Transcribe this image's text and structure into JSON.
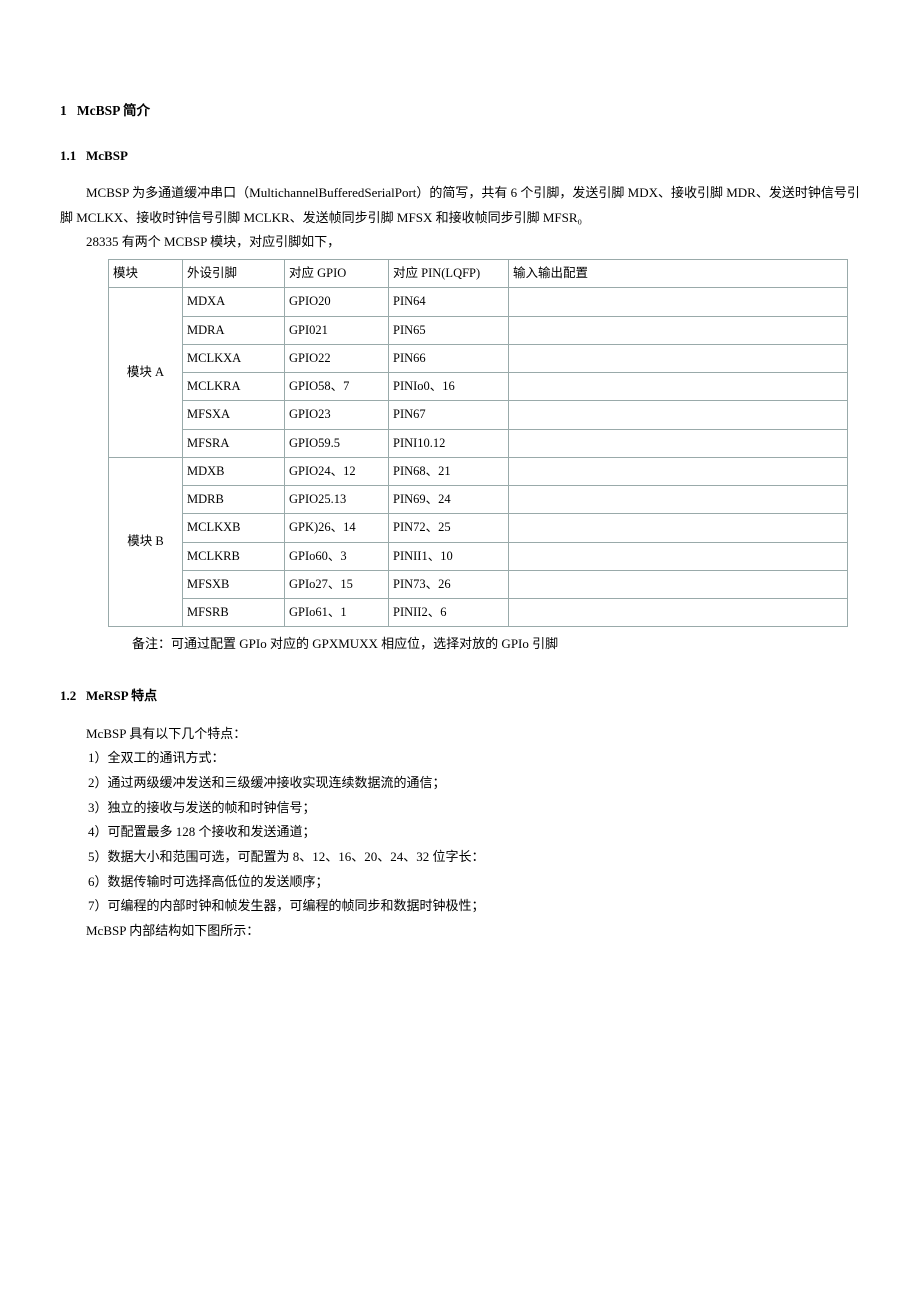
{
  "sec1": {
    "num": "1",
    "title": "McBSP 简介"
  },
  "sec11": {
    "num": "1.1",
    "title": "McBSP"
  },
  "para1": "MCBSP 为多通道缓冲串口（MultichannelBufferedSerialPort）的简写，共有 6 个引脚，发送引脚 MDX、接收引脚 MDR、发送时钟信号引脚 MCLKX、接收时钟信号引脚 MCLKR、发送帧同步引脚 MFSX 和接收帧同步引脚 MFSR₀",
  "para2": "28335 有两个 MCBSP 模块，对应引脚如下，",
  "table": {
    "headers": {
      "mod": "模块",
      "pin": "外设引脚",
      "gpio": "对应 GPIO",
      "pinlqfp": "对应 PIN(LQFP)",
      "io": "输入输出配置"
    },
    "modA": "模块 A",
    "modB": "模块 B",
    "rowsA": [
      {
        "pin": "MDXA",
        "gpio": "GPIO20",
        "pinlqfp": "PIN64",
        "io": ""
      },
      {
        "pin": "MDRA",
        "gpio": "GPI021",
        "pinlqfp": "PIN65",
        "io": ""
      },
      {
        "pin": "MCLKXA",
        "gpio": "GPIO22",
        "pinlqfp": "PIN66",
        "io": ""
      },
      {
        "pin": "MCLKRA",
        "gpio": "GPIO58、7",
        "pinlqfp": "PINIo0、16",
        "io": ""
      },
      {
        "pin": "MFSXA",
        "gpio": "GPIO23",
        "pinlqfp": "PIN67",
        "io": ""
      },
      {
        "pin": "MFSRA",
        "gpio": "GPIO59.5",
        "pinlqfp": "PINI10.12",
        "io": ""
      }
    ],
    "rowsB": [
      {
        "pin": "MDXB",
        "gpio": "GPIO24、12",
        "pinlqfp": "PIN68、21",
        "io": ""
      },
      {
        "pin": "MDRB",
        "gpio": "GPIO25.13",
        "pinlqfp": "PIN69、24",
        "io": ""
      },
      {
        "pin": "MCLKXB",
        "gpio": "GPK)26、14",
        "pinlqfp": "PIN72、25",
        "io": ""
      },
      {
        "pin": "MCLKRB",
        "gpio": "GPIo60、3",
        "pinlqfp": "PINII1、10",
        "io": ""
      },
      {
        "pin": "MFSXB",
        "gpio": "GPIo27、15",
        "pinlqfp": "PIN73、26",
        "io": ""
      },
      {
        "pin": "MFSRB",
        "gpio": "GPIo61、1",
        "pinlqfp": "PINII2、6",
        "io": ""
      }
    ]
  },
  "tableNote": "备注：可通过配置 GPIo 对应的 GPXMUXX 相应位，选择对放的 GPIo 引脚",
  "sec12": {
    "num": "1.2",
    "title": "MeRSP 特点"
  },
  "para3": "McBSP 具有以下几个特点：",
  "items": [
    "1）全双工的通讯方式：",
    "2）通过两级缓冲发送和三级缓冲接收实现连续数据流的通信；",
    "3）独立的接收与发送的帧和时钟信号；",
    "4）可配置最多 128 个接收和发送通道；",
    "5）数据大小和范围可选，可配置为 8、12、16、20、24、32 位字长：",
    "6）数据传输时可选择高低位的发送顺序；",
    "7）可编程的内部时钟和帧发生器，可编程的帧同步和数据时钟极性；"
  ],
  "para4": "McBSP 内部结构如下图所示："
}
